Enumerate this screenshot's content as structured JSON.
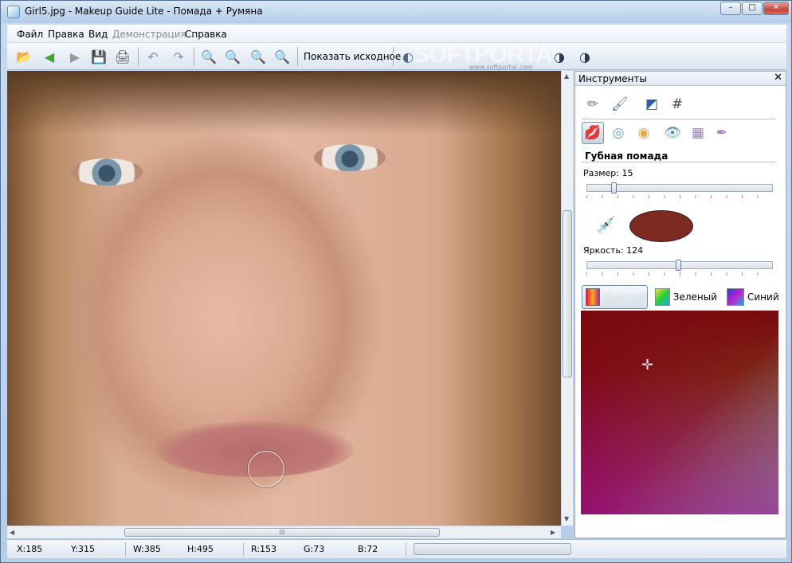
{
  "window": {
    "title": "Girl5.jpg - Makeup Guide Lite - Помада + Румяна",
    "buttons": {
      "minimize": "–",
      "maximize": "□",
      "close": "✕"
    }
  },
  "menu": [
    {
      "label": "Файл",
      "enabled": true
    },
    {
      "label": "Правка",
      "enabled": true
    },
    {
      "label": "Вид",
      "enabled": true
    },
    {
      "label": "Демонстрация",
      "enabled": false
    },
    {
      "label": "Справка",
      "enabled": true
    }
  ],
  "toolbar": {
    "show_original_label": "Показать исходное",
    "buttons": [
      "open-icon",
      "back-icon",
      "forward-icon",
      "save-icon",
      "print-icon",
      "undo-icon",
      "redo-icon",
      "zoom-in-icon",
      "zoom-out-icon",
      "zoom-fit-icon",
      "zoom-actual-icon"
    ],
    "watermark": "SOFTPORTAL",
    "watermark_sub": "www.softportal.com"
  },
  "panel": {
    "title": "Инструменты",
    "close": "✕",
    "section_title": "Губная помада",
    "size_label": "Размер: 15",
    "brightness_label": "Яркость: 124",
    "size_value": 15,
    "brightness_value": 124,
    "color_swatch": "#7c2a22",
    "tabs": [
      {
        "label": "Красный",
        "active": true
      },
      {
        "label": "Зеленый",
        "active": false
      },
      {
        "label": "Синий",
        "active": false
      }
    ]
  },
  "status": {
    "x": "X:185",
    "y": "Y:315",
    "w": "W:385",
    "h": "H:495",
    "r": "R:153",
    "g": "G:73",
    "b": "B:72"
  },
  "scroll": {
    "grip": "III"
  }
}
